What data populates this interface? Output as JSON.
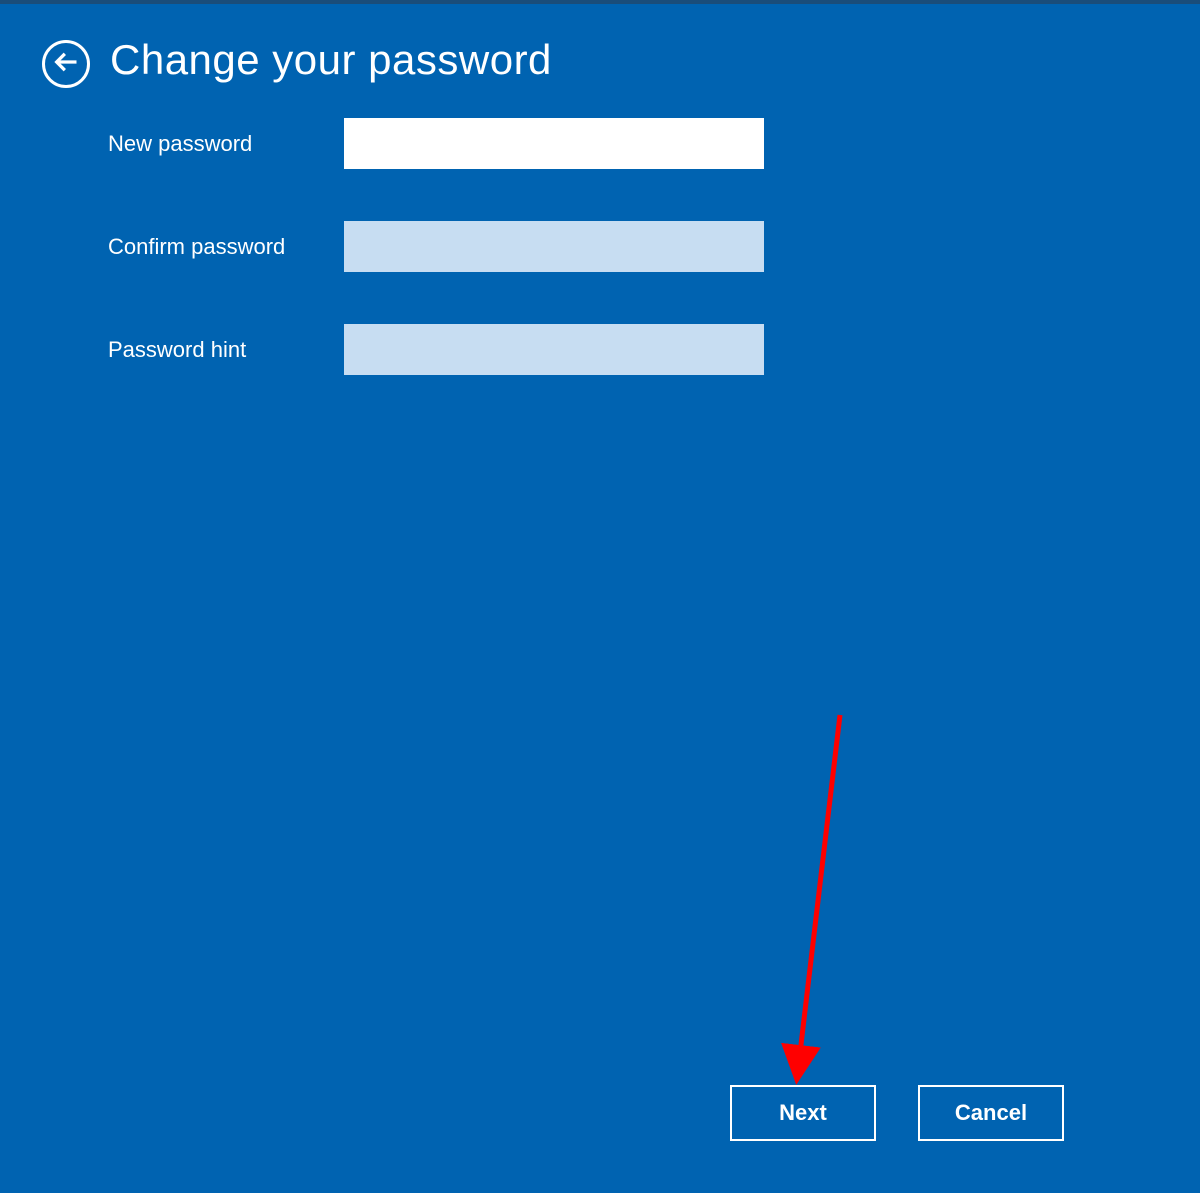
{
  "header": {
    "title": "Change your password"
  },
  "form": {
    "new_password": {
      "label": "New password",
      "value": ""
    },
    "confirm_password": {
      "label": "Confirm password",
      "value": ""
    },
    "password_hint": {
      "label": "Password hint",
      "value": ""
    }
  },
  "buttons": {
    "next": "Next",
    "cancel": "Cancel"
  },
  "annotation": {
    "type": "arrow",
    "color": "#ff0000",
    "target": "next-button"
  }
}
